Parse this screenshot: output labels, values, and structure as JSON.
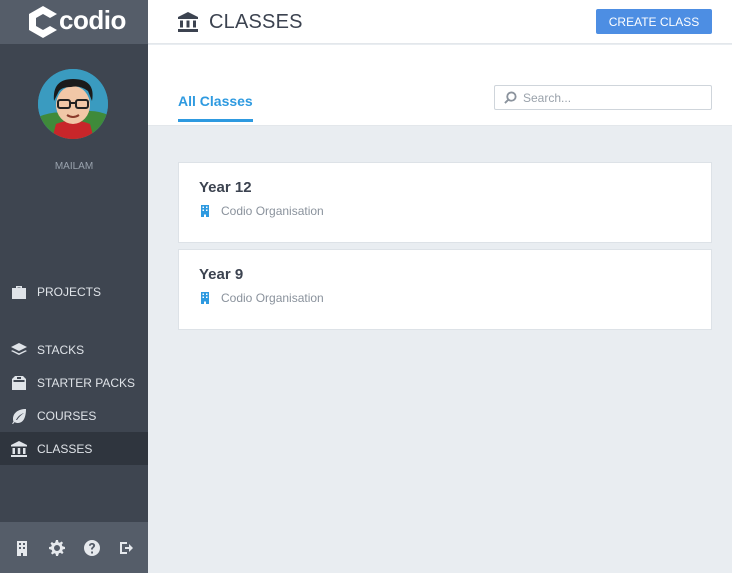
{
  "app": {
    "logo_text": "codio"
  },
  "user": {
    "name": "MAILAM"
  },
  "sidebar": {
    "items": [
      {
        "label": "PROJECTS",
        "icon": "briefcase-icon"
      },
      {
        "label": "STACKS",
        "icon": "layers-icon"
      },
      {
        "label": "STARTER PACKS",
        "icon": "box-icon"
      },
      {
        "label": "COURSES",
        "icon": "leaf-icon"
      },
      {
        "label": "CLASSES",
        "icon": "institution-icon",
        "active": true
      }
    ],
    "bottom_icons": [
      "building-icon",
      "gear-icon",
      "help-icon",
      "logout-icon"
    ]
  },
  "header": {
    "title": "CLASSES",
    "create_button": "CREATE CLASS"
  },
  "tabs": {
    "all_label": "All Classes"
  },
  "search": {
    "placeholder": "Search..."
  },
  "classes": [
    {
      "name": "Year 12",
      "org": "Codio Organisation"
    },
    {
      "name": "Year 9",
      "org": "Codio Organisation"
    }
  ],
  "colors": {
    "accent": "#2e9ae0",
    "button": "#4d8ee3",
    "sidebar": "#3e4550",
    "sidebar_active": "#2f353e"
  }
}
